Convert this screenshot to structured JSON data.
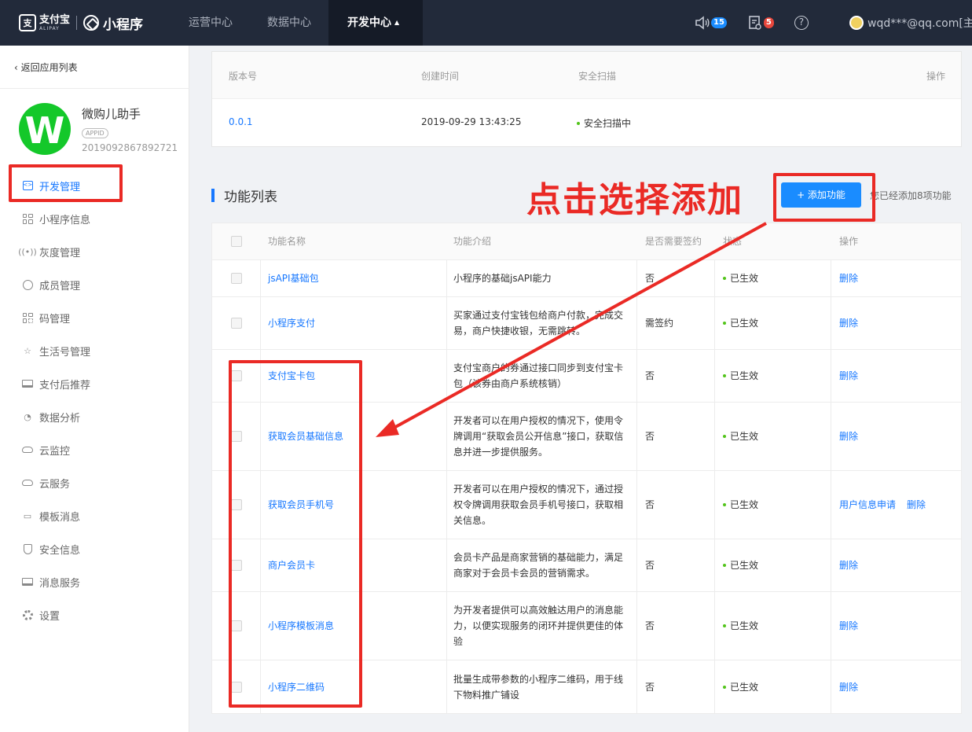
{
  "topbar": {
    "brand_alipay_cn": "支付宝",
    "brand_alipay_en": "ALIPAY",
    "brand_mini": "小程序",
    "nav": [
      {
        "label": "运营中心",
        "active": false
      },
      {
        "label": "数据中心",
        "active": false
      },
      {
        "label": "开发中心",
        "active": true
      }
    ],
    "notifications_count": "15",
    "tasks_count": "5",
    "help_glyph": "?",
    "user_email": "wqd***@qq.com[主账"
  },
  "sidebar": {
    "back_label": "返回应用列表",
    "app_name": "微购儿助手",
    "app_logo_letter": "W",
    "appid_tag": "APPID",
    "appid": "2019092867892721",
    "menu": [
      {
        "label": "开发管理",
        "icon": "code-icon",
        "active": true
      },
      {
        "label": "小程序信息",
        "icon": "grid-icon",
        "active": false
      },
      {
        "label": "灰度管理",
        "icon": "broadcast-icon",
        "active": false
      },
      {
        "label": "成员管理",
        "icon": "user-icon",
        "active": false
      },
      {
        "label": "码管理",
        "icon": "qrcode-icon",
        "active": false
      },
      {
        "label": "生活号管理",
        "icon": "star-icon",
        "active": false
      },
      {
        "label": "支付后推荐",
        "icon": "laptop-icon",
        "active": false
      },
      {
        "label": "数据分析",
        "icon": "pie-icon",
        "active": false
      },
      {
        "label": "云监控",
        "icon": "cloud-icon",
        "active": false
      },
      {
        "label": "云服务",
        "icon": "cloud-icon",
        "active": false
      },
      {
        "label": "模板消息",
        "icon": "message-icon",
        "active": false
      },
      {
        "label": "安全信息",
        "icon": "shield-icon",
        "active": false
      },
      {
        "label": "消息服务",
        "icon": "monitor-icon",
        "active": false
      },
      {
        "label": "设置",
        "icon": "gear-icon",
        "active": false
      }
    ]
  },
  "version": {
    "headers": {
      "version": "版本号",
      "created": "创建时间",
      "scan": "安全扫描",
      "action": "操作"
    },
    "row": {
      "version": "0.0.1",
      "created": "2019-09-29 13:43:25",
      "scan": "安全扫描中"
    }
  },
  "features": {
    "title": "功能列表",
    "add_button": "+ 添加功能",
    "added_count": "您已经添加8项功能",
    "headers": {
      "name": "功能名称",
      "desc": "功能介绍",
      "sign": "是否需要签约",
      "status": "状态",
      "action": "操作"
    },
    "rows": [
      {
        "name": "jsAPI基础包",
        "desc": "小程序的基础jsAPI能力",
        "sign": "否",
        "status": "已生效",
        "actions": [
          "删除"
        ]
      },
      {
        "name": "小程序支付",
        "desc": "买家通过支付宝钱包给商户付款，完成交易，商户快捷收银，无需跳转。",
        "sign": "需签约",
        "status": "已生效",
        "actions": [
          "删除"
        ]
      },
      {
        "name": "支付宝卡包",
        "desc": "支付宝商户的券通过接口同步到支付宝卡包（该券由商户系统核销）",
        "sign": "否",
        "status": "已生效",
        "actions": [
          "删除"
        ]
      },
      {
        "name": "获取会员基础信息",
        "desc": "开发者可以在用户授权的情况下，使用令牌调用“获取会员公开信息”接口，获取信息并进一步提供服务。",
        "sign": "否",
        "status": "已生效",
        "actions": [
          "删除"
        ]
      },
      {
        "name": "获取会员手机号",
        "desc": "开发者可以在用户授权的情况下，通过授权令牌调用获取会员手机号接口，获取相关信息。",
        "sign": "否",
        "status": "已生效",
        "actions": [
          "用户信息申请",
          "删除"
        ]
      },
      {
        "name": "商户会员卡",
        "desc": "会员卡产品是商家营销的基础能力，满足商家对于会员卡会员的营销需求。",
        "sign": "否",
        "status": "已生效",
        "actions": [
          "删除"
        ]
      },
      {
        "name": "小程序模板消息",
        "desc": "为开发者提供可以高效触达用户的消息能力，以便实现服务的闭环并提供更佳的体验",
        "sign": "否",
        "status": "已生效",
        "actions": [
          "删除"
        ]
      },
      {
        "name": "小程序二维码",
        "desc": "批量生成带参数的小程序二维码，用于线下物料推广铺设",
        "sign": "否",
        "status": "已生效",
        "actions": [
          "删除"
        ]
      }
    ]
  },
  "annotation": {
    "text": "点击选择添加",
    "color": "#ea2a25"
  },
  "colors": {
    "topbar": "#222a3a",
    "accent": "#1677ff",
    "button": "#1a8cff",
    "app_logo": "#14c82a",
    "status_green": "#52c41a"
  }
}
